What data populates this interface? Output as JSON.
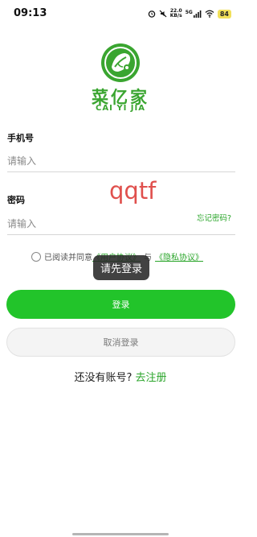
{
  "status_bar": {
    "time": "09:13",
    "network_speed_value": "22.0",
    "network_speed_unit": "KB/s",
    "network_gen": "5G",
    "battery": "84",
    "icons": [
      "alarm-icon",
      "mute-icon",
      "signal-icon",
      "wifi-icon",
      "battery-icon"
    ]
  },
  "brand": {
    "name_cn": "菜亿家",
    "name_en": "CAI YI JIA",
    "color": "#3aa530"
  },
  "form": {
    "phone_label": "手机号",
    "phone_placeholder": "请输入",
    "password_label": "密码",
    "password_placeholder": "请输入",
    "forgot_password": "忘记密码?"
  },
  "watermark": "qqtf",
  "agreement": {
    "prefix": "已阅读并同意",
    "user_agreement": "《用户协议》",
    "conjunction": "与",
    "privacy_policy": "《隐私协议》"
  },
  "toast": "请先登录",
  "buttons": {
    "login": "登录",
    "cancel": "取消登录"
  },
  "register": {
    "prompt": "还没有账号?",
    "link": "去注册"
  },
  "colors": {
    "accent_green": "#22c42a",
    "link_green": "#2aa52a",
    "watermark_red": "#e0504d"
  }
}
